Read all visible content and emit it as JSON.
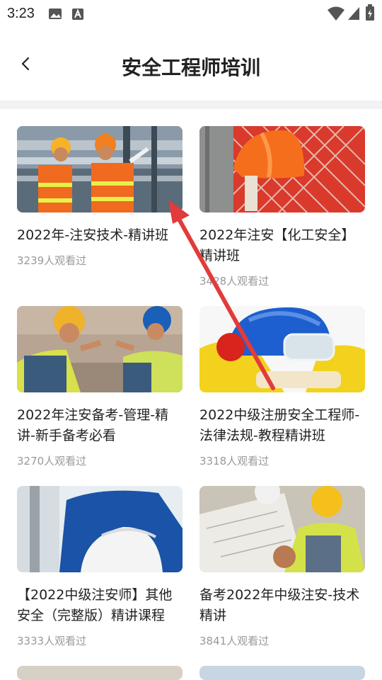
{
  "status_bar": {
    "time": "3:23"
  },
  "header": {
    "title": "安全工程师培训"
  },
  "courses": [
    {
      "title": "2022年-注安技术-精讲班",
      "views": "3239人观看过"
    },
    {
      "title": "2022年注安【化工安全】精讲班",
      "views": "3428人观看过"
    },
    {
      "title": "2022年注安备考-管理-精讲-新手备考必看",
      "views": "3270人观看过"
    },
    {
      "title": "2022中级注册安全工程师-法律法规-教程精讲班",
      "views": "3318人观看过"
    },
    {
      "title": "【2022中级注安师】其他安全（完整版）精讲课程",
      "views": "3333人观看过"
    },
    {
      "title": "备考2022年中级注安-技术精讲",
      "views": "3841人观看过"
    }
  ],
  "colors": {
    "accent_arrow": "#e23b3b",
    "divider": "#f2f2f4"
  }
}
